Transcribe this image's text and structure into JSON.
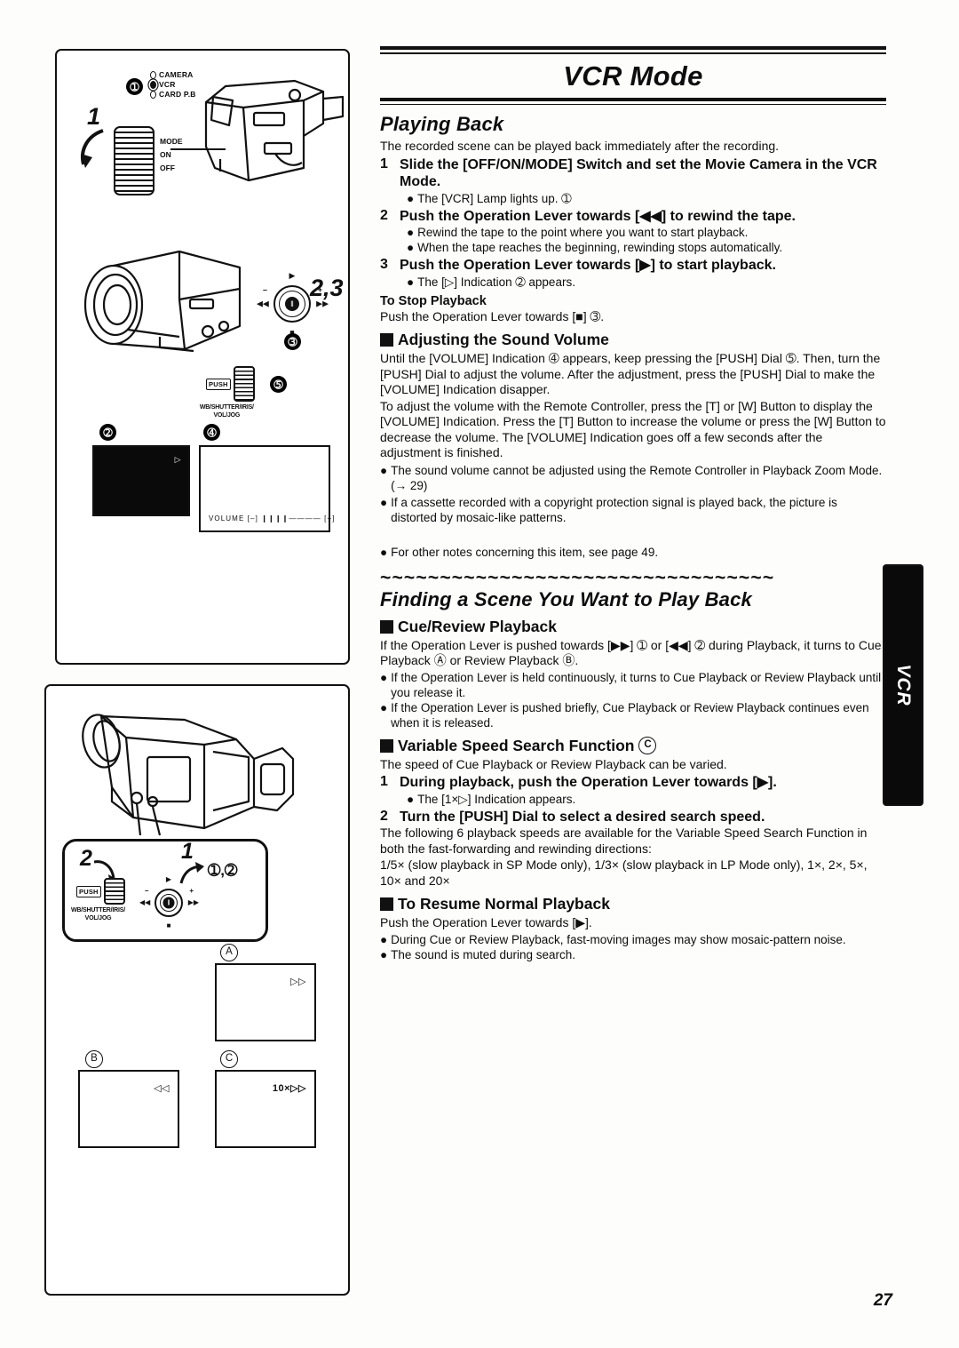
{
  "document": {
    "title": "VCR Mode",
    "page_number": "27",
    "side_tab_label": "VCR"
  },
  "sections": {
    "playing_back": {
      "heading": "Playing Back",
      "intro": "The recorded scene can be played back immediately after the recording.",
      "steps": [
        {
          "n": "1",
          "text": "Slide the [OFF/ON/MODE] Switch and set the Movie Camera in the VCR Mode.",
          "notes": [
            "The [VCR] Lamp lights up. ➀"
          ]
        },
        {
          "n": "2",
          "text": "Push the Operation Lever towards  [◀◀] to rewind the tape.",
          "notes": [
            "Rewind the tape to the point where you want to start playback.",
            "When the tape reaches the beginning, rewinding stops automatically."
          ]
        },
        {
          "n": "3",
          "text": "Push the Operation Lever towards  [▶] to start playback.",
          "notes": [
            "The [▷] Indication ➁ appears."
          ]
        }
      ],
      "stop_heading": "To Stop Playback",
      "stop_text": "Push the Operation Lever towards  [■] ➂."
    },
    "sound_volume": {
      "heading": "Adjusting the Sound Volume",
      "paragraph_1": "Until the [VOLUME] Indication ➃ appears, keep pressing the [PUSH] Dial ➄. Then, turn the [PUSH] Dial to adjust the volume. After the adjustment, press the [PUSH] Dial to make the [VOLUME] Indication disapper.",
      "paragraph_2": "To adjust the volume with the Remote Controller, press the [T] or [W] Button to display the [VOLUME] Indication. Press the [T] Button to increase the volume or press the [W] Button to decrease the volume. The [VOLUME] Indication goes off a few seconds after the adjustment is finished.",
      "notes": [
        "The sound volume cannot be adjusted using the Remote Controller in Playback Zoom Mode. (→ 29)",
        "If a cassette recorded with a copyright protection signal is played back, the picture is distorted by mosaic-like patterns."
      ],
      "see_also": "For other notes concerning this item, see page 49."
    },
    "finding_scene": {
      "heading": "Finding a Scene You Want to Play Back",
      "squiggle": "~~~~~~~~~~~~~~~~~~~~~~~~~~~~~~~~~",
      "cue_review": {
        "heading": "Cue/Review Playback",
        "paragraph": "If the Operation Lever is pushed towards  [▶▶] ➀ or [◀◀] ➁ during Playback, it turns to Cue Playback Ⓐ or Review Playback Ⓑ.",
        "notes": [
          "If the Operation Lever is held continuously, it turns to Cue Playback or Review Playback until you release it.",
          "If the Operation Lever is pushed briefly, Cue Playback or Review Playback continues even when it is released."
        ]
      },
      "variable_speed": {
        "heading": "Variable Speed Search Function",
        "heading_ref": "C",
        "intro": "The speed of Cue Playback or Review Playback can be varied.",
        "steps": [
          {
            "n": "1",
            "text": "During playback, push the Operation Lever towards [▶].",
            "notes": [
              "The [1×▷] Indication appears."
            ]
          },
          {
            "n": "2",
            "text": "Turn the [PUSH] Dial to select a desired search speed.",
            "notes": []
          }
        ],
        "speeds_intro": "The following 6 playback speeds are available for the Variable Speed Search Function in both the fast-forwarding and rewinding directions:",
        "speeds_list": "1/5× (slow playback in SP Mode only), 1/3× (slow playback in LP Mode only), 1×, 2×, 5×, 10× and 20×"
      },
      "resume": {
        "heading": "To Resume Normal Playback",
        "text": "Push the Operation Lever towards [▶].",
        "notes": [
          "During Cue or Review Playback, fast-moving images may show mosaic-pattern noise.",
          "The sound is muted during search."
        ]
      }
    }
  },
  "figures": {
    "panel_1": {
      "callout_1": "➀",
      "callout_2": "➁",
      "callout_3": "➂",
      "callout_4": "➃",
      "callout_5": "➄",
      "step_label_1": "1",
      "step_label_23": "2,3",
      "lamps": [
        "CAMERA",
        "VCR",
        "CARD P.B"
      ],
      "dial_labels": [
        "MODE",
        "ON",
        "OFF"
      ],
      "push_tag": "PUSH",
      "push_caption_line1": "WB/SHUTTER/IRIS/",
      "push_caption_line2": "VOL/JOG",
      "lever_up": "▶",
      "lever_down": "■",
      "lever_left": "◀◀",
      "lever_right": "▶▶",
      "lever_center": "‖",
      "lever_minus": "–",
      "lever_plus": "+",
      "screen_2_osd": "▷",
      "screen_4_osd": "VOLUME  [–] ❙❙❙❙———— [+]"
    },
    "panel_2": {
      "step_label_1": "1",
      "step_label_2": "2",
      "callout_12": "➀,➁",
      "push_tag": "PUSH",
      "push_caption_line1": "WB/SHUTTER/IRIS/",
      "push_caption_line2": "VOL/JOG",
      "screens": [
        {
          "ref": "A",
          "osd": "▷▷"
        },
        {
          "ref": "B",
          "osd": "◁◁"
        },
        {
          "ref": "C",
          "osd": "10×▷▷"
        }
      ]
    }
  }
}
